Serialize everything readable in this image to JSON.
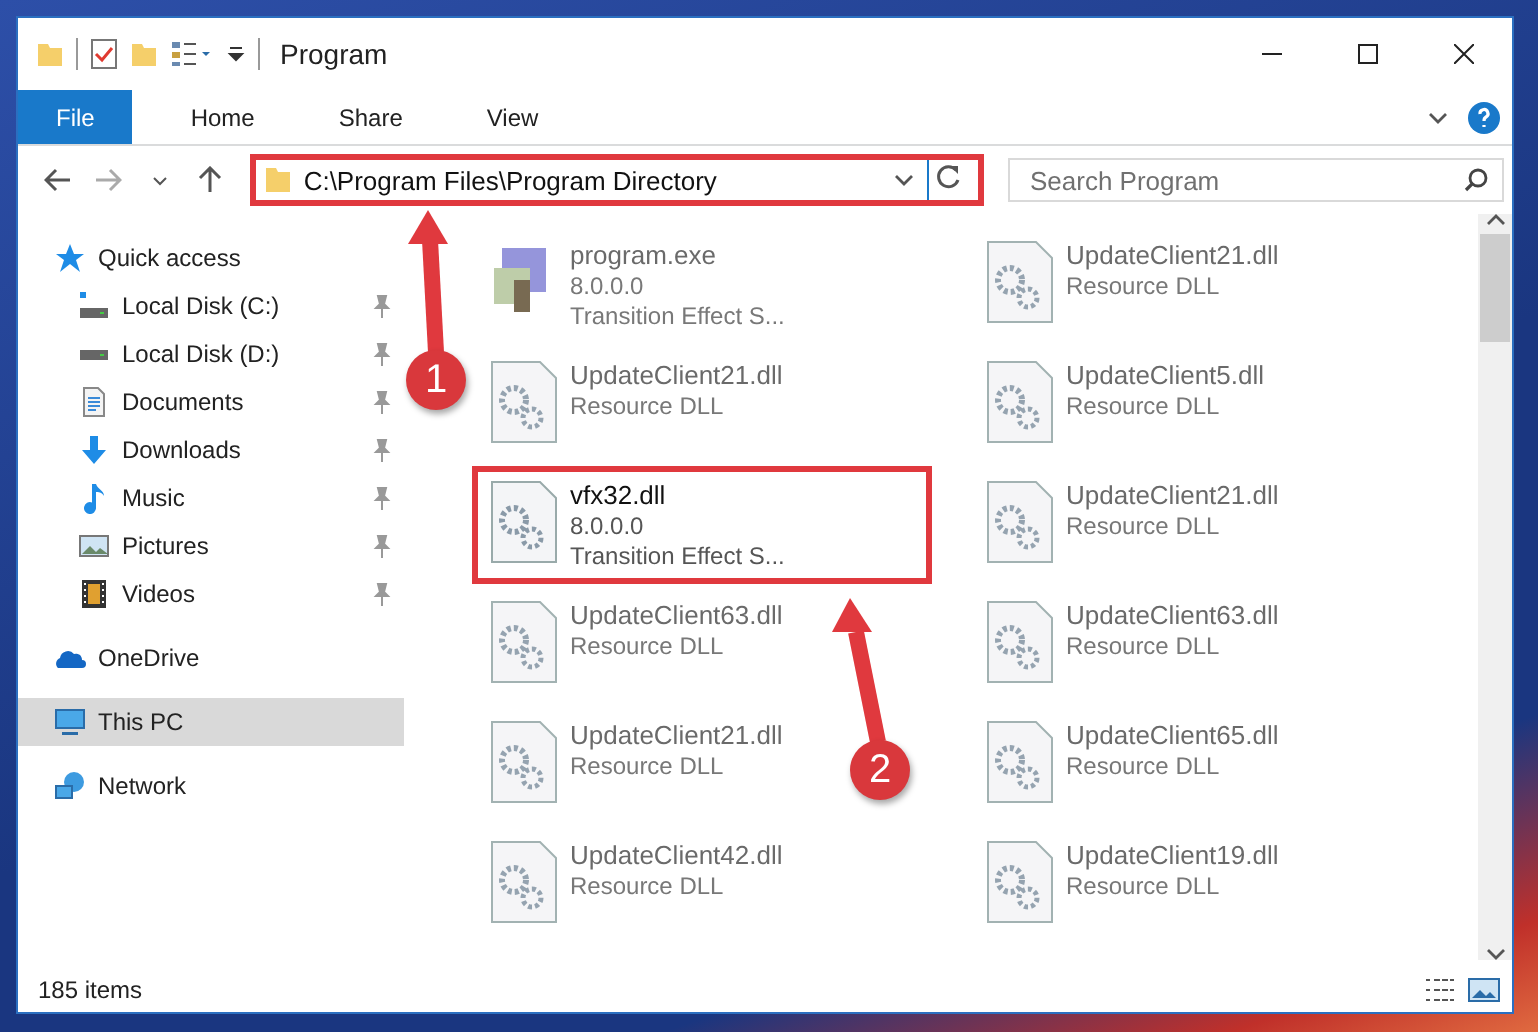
{
  "window": {
    "title": "Program"
  },
  "ribbon_tabs": [
    {
      "label": "File",
      "selected": true
    },
    {
      "label": "Home",
      "selected": false
    },
    {
      "label": "Share",
      "selected": false
    },
    {
      "label": "View",
      "selected": false
    }
  ],
  "address_bar": {
    "path": "C:\\Program Files\\Program Directory",
    "highlighted": true
  },
  "search": {
    "placeholder": "Search Program"
  },
  "sidebar": {
    "items": [
      {
        "label": "Quick access",
        "kind": "star",
        "selected": false,
        "children": [
          {
            "label": "Local Disk (C:)",
            "kind": "drive-c",
            "pinned": true
          },
          {
            "label": "Local Disk (D:)",
            "kind": "drive",
            "pinned": true
          },
          {
            "label": "Documents",
            "kind": "documents",
            "pinned": true
          },
          {
            "label": "Downloads",
            "kind": "downloads",
            "pinned": true
          },
          {
            "label": "Music",
            "kind": "music",
            "pinned": true
          },
          {
            "label": "Pictures",
            "kind": "pictures",
            "pinned": true
          },
          {
            "label": "Videos",
            "kind": "videos",
            "pinned": true
          }
        ]
      },
      {
        "label": "OneDrive",
        "kind": "cloud",
        "selected": false
      },
      {
        "label": "This PC",
        "kind": "pc",
        "selected": true
      },
      {
        "label": "Network",
        "kind": "network",
        "selected": false
      }
    ]
  },
  "files": [
    {
      "name": "program.exe",
      "kind": "exe",
      "details": [
        "8.0.0.0",
        "Transition Effect S..."
      ],
      "blurred": true,
      "highlighted": false
    },
    {
      "name": "UpdateClient21.dll",
      "kind": "dll",
      "details": [
        "Resource DLL"
      ],
      "blurred": true,
      "highlighted": false
    },
    {
      "name": "UpdateClient21.dll",
      "kind": "dll",
      "details": [
        "Resource DLL"
      ],
      "blurred": true,
      "highlighted": false
    },
    {
      "name": "UpdateClient5.dll",
      "kind": "dll",
      "details": [
        "Resource DLL"
      ],
      "blurred": true,
      "highlighted": false
    },
    {
      "name": "vfx32.dll",
      "kind": "dll",
      "details": [
        "8.0.0.0",
        "Transition Effect S..."
      ],
      "blurred": false,
      "highlighted": true
    },
    {
      "name": "UpdateClient21.dll",
      "kind": "dll",
      "details": [
        "Resource DLL"
      ],
      "blurred": true,
      "highlighted": false
    },
    {
      "name": "UpdateClient63.dll",
      "kind": "dll",
      "details": [
        "Resource DLL"
      ],
      "blurred": true,
      "highlighted": false
    },
    {
      "name": "UpdateClient63.dll",
      "kind": "dll",
      "details": [
        "Resource DLL"
      ],
      "blurred": true,
      "highlighted": false
    },
    {
      "name": "UpdateClient21.dll",
      "kind": "dll",
      "details": [
        "Resource DLL"
      ],
      "blurred": true,
      "highlighted": false
    },
    {
      "name": "UpdateClient65.dll",
      "kind": "dll",
      "details": [
        "Resource DLL"
      ],
      "blurred": true,
      "highlighted": false
    },
    {
      "name": "UpdateClient42.dll",
      "kind": "dll",
      "details": [
        "Resource DLL"
      ],
      "blurred": true,
      "highlighted": false
    },
    {
      "name": "UpdateClient19.dll",
      "kind": "dll",
      "details": [
        "Resource DLL"
      ],
      "blurred": true,
      "highlighted": false
    }
  ],
  "status_bar": {
    "item_count": "185 items"
  },
  "callouts": [
    {
      "number": "1"
    },
    {
      "number": "2"
    }
  ]
}
